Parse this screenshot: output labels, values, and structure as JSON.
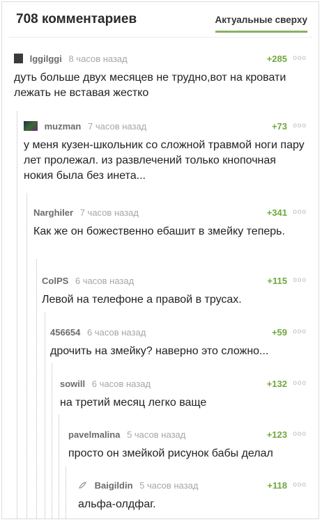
{
  "header": {
    "comments_count": "708 комментариев",
    "sort_tab": "Актуальные сверху"
  },
  "comments": [
    {
      "author": "lggilggi",
      "time": "8 часов назад",
      "rating": "+285",
      "text": "дуть больше двух месяцев не трудно,вот на кровати лежать не вставая жестко"
    },
    {
      "author": "muzman",
      "time": "7 часов назад",
      "rating": "+73",
      "text": "у меня кузен-школьник со сложной травмой ноги пару лет пролежал. из развлечений только кнопочная нокия была без инета..."
    },
    {
      "author": "Narghiler",
      "time": "7 часов назад",
      "rating": "+341",
      "text": "Как же он божественно ебашит в змейку теперь."
    },
    {
      "author": "ColPS",
      "time": "6 часов назад",
      "rating": "+115",
      "text": "Левой на телефоне а правой в трусах."
    },
    {
      "author": "456654",
      "time": "6 часов назад",
      "rating": "+59",
      "text": "дрочить на змейку? наверно это сложно..."
    },
    {
      "author": "sowill",
      "time": "6 часов назад",
      "rating": "+132",
      "text": "на третий месяц легко ваще"
    },
    {
      "author": "pavelmalina",
      "time": "5 часов назад",
      "rating": "+123",
      "text": "просто он змейкой рисунок бабы делал"
    },
    {
      "author": "Baigildin",
      "time": "5 часов назад",
      "rating": "+118",
      "text": "альфа-олдфаг."
    }
  ],
  "more_glyph": "ooo",
  "colors": {
    "rating": "#70a83f",
    "accent": "#8ab060"
  }
}
